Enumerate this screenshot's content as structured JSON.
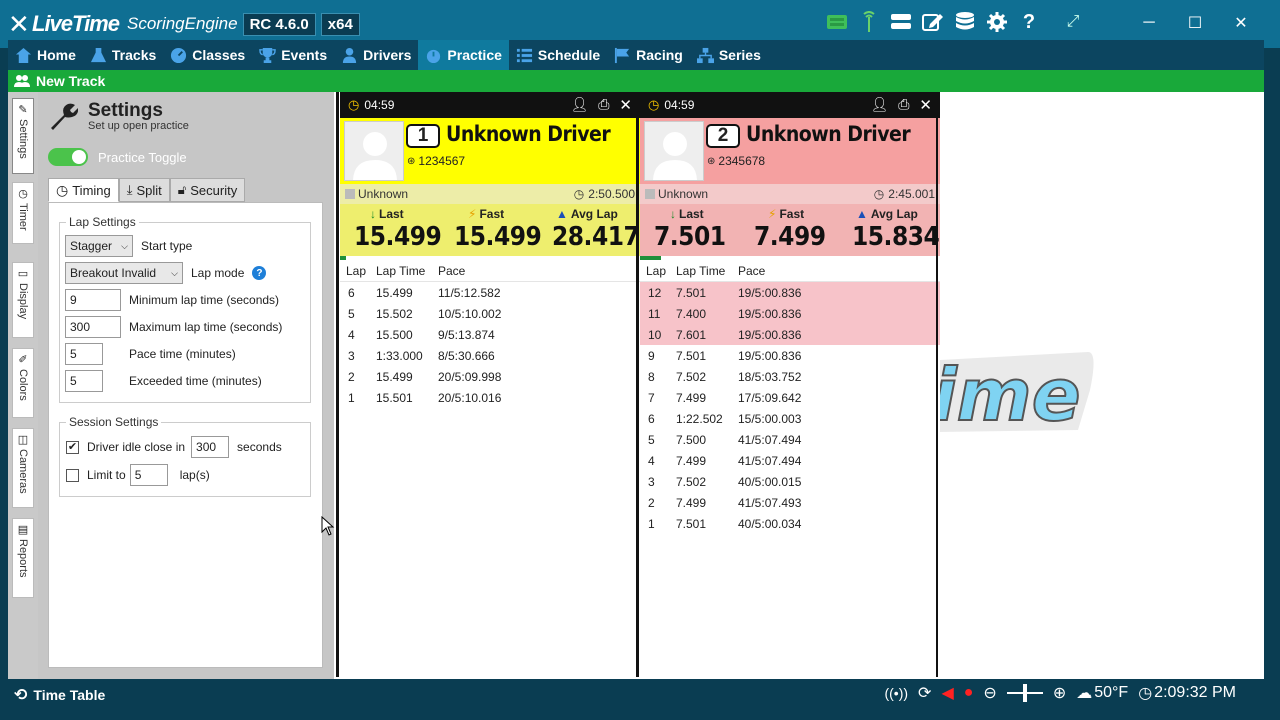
{
  "app": {
    "brand_live": "LiveTime",
    "brand_engine": "ScoringEngine",
    "version": "RC 4.6.0",
    "arch": "x64"
  },
  "nav": {
    "items": [
      {
        "label": "Home",
        "icon": "home-icon"
      },
      {
        "label": "Tracks",
        "icon": "flask-icon"
      },
      {
        "label": "Classes",
        "icon": "gauge-icon"
      },
      {
        "label": "Events",
        "icon": "trophy-icon"
      },
      {
        "label": "Drivers",
        "icon": "user-icon"
      },
      {
        "label": "Practice",
        "icon": "stopwatch-icon"
      },
      {
        "label": "Schedule",
        "icon": "list-icon"
      },
      {
        "label": "Racing",
        "icon": "flag-icon"
      },
      {
        "label": "Series",
        "icon": "hierarchy-icon"
      }
    ]
  },
  "subbar": {
    "label": "New Track"
  },
  "side_tabs": [
    "Settings",
    "Timer",
    "Display",
    "Colors",
    "Cameras",
    "Reports"
  ],
  "settings": {
    "title": "Settings",
    "subtitle": "Set up open practice",
    "toggle_label": "Practice Toggle",
    "tabs": [
      "Timing",
      "Split",
      "Security"
    ],
    "lap_settings": {
      "legend": "Lap Settings",
      "start_type_value": "Stagger",
      "start_type_label": "Start type",
      "lap_mode_value": "Breakout Invalid",
      "lap_mode_label": "Lap mode",
      "min_lap_value": "9",
      "min_lap_label": "Minimum lap time (seconds)",
      "max_lap_value": "300",
      "max_lap_label": "Maximum lap time (seconds)",
      "pace_value": "5",
      "pace_label": "Pace time (minutes)",
      "exceeded_value": "5",
      "exceeded_label": "Exceeded time (minutes)"
    },
    "session_settings": {
      "legend": "Session Settings",
      "idle_label": "Driver idle close in",
      "idle_value": "300",
      "idle_unit": "seconds",
      "idle_checked": true,
      "limit_label": "Limit to",
      "limit_value": "5",
      "limit_unit": "lap(s)",
      "limit_checked": false
    }
  },
  "cards": [
    {
      "timer": "04:59",
      "number": "1",
      "name": "Unknown Driver",
      "transponder": "1234567",
      "class": "Unknown",
      "elapsed": "2:50.500",
      "last_label": "Last",
      "fast_label": "Fast",
      "avg_label": "Avg Lap",
      "last": "15.499",
      "fast": "15.499",
      "avg": "28.417",
      "color": "#ffff00",
      "info_color": "#ededa8",
      "stats_color": "#eeee6e",
      "progress": 0.02,
      "columns": [
        "Lap",
        "Lap Time",
        "Pace"
      ],
      "laps": [
        {
          "lap": "6",
          "time": "15.499",
          "pace": "11/5:12.582",
          "highlight": false
        },
        {
          "lap": "5",
          "time": "15.502",
          "pace": "10/5:10.002",
          "highlight": false
        },
        {
          "lap": "4",
          "time": "15.500",
          "pace": "9/5:13.874",
          "highlight": false
        },
        {
          "lap": "3",
          "time": "1:33.000",
          "pace": "8/5:30.666",
          "highlight": false
        },
        {
          "lap": "2",
          "time": "15.499",
          "pace": "20/5:09.998",
          "highlight": false
        },
        {
          "lap": "1",
          "time": "15.501",
          "pace": "20/5:10.016",
          "highlight": false
        }
      ]
    },
    {
      "timer": "04:59",
      "number": "2",
      "name": "Unknown Driver",
      "transponder": "2345678",
      "class": "Unknown",
      "elapsed": "2:45.001",
      "last_label": "Last",
      "fast_label": "Fast",
      "avg_label": "Avg Lap",
      "last": "7.501",
      "fast": "7.499",
      "avg": "15.834",
      "color": "#f5a0a0",
      "info_color": "#f3caca",
      "stats_color": "#f2b3b3",
      "progress": 0.07,
      "columns": [
        "Lap",
        "Lap Time",
        "Pace"
      ],
      "laps": [
        {
          "lap": "12",
          "time": "7.501",
          "pace": "19/5:00.836",
          "highlight": true
        },
        {
          "lap": "11",
          "time": "7.400",
          "pace": "19/5:00.836",
          "highlight": true
        },
        {
          "lap": "10",
          "time": "7.601",
          "pace": "19/5:00.836",
          "highlight": true
        },
        {
          "lap": "9",
          "time": "7.501",
          "pace": "19/5:00.836",
          "highlight": false
        },
        {
          "lap": "8",
          "time": "7.502",
          "pace": "18/5:03.752",
          "highlight": false
        },
        {
          "lap": "7",
          "time": "7.499",
          "pace": "17/5:09.642",
          "highlight": false
        },
        {
          "lap": "6",
          "time": "1:22.502",
          "pace": "15/5:00.003",
          "highlight": false
        },
        {
          "lap": "5",
          "time": "7.500",
          "pace": "41/5:07.494",
          "highlight": false
        },
        {
          "lap": "4",
          "time": "7.499",
          "pace": "41/5:07.494",
          "highlight": false
        },
        {
          "lap": "3",
          "time": "7.502",
          "pace": "40/5:00.015",
          "highlight": false
        },
        {
          "lap": "2",
          "time": "7.499",
          "pace": "41/5:07.493",
          "highlight": false
        },
        {
          "lap": "1",
          "time": "7.501",
          "pace": "40/5:00.034",
          "highlight": false
        }
      ]
    }
  ],
  "watermark_text": "ime",
  "statusbar": {
    "left_label": "Time Table",
    "temperature": "50°F",
    "clock": "2:09:32 PM"
  }
}
